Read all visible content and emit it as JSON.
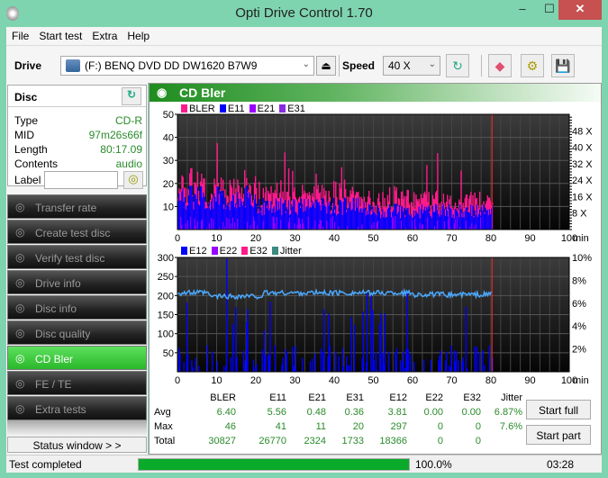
{
  "window": {
    "title": "Opti Drive Control 1.70",
    "minimize": "‒",
    "maximize": "☐",
    "close": "✕"
  },
  "menu": [
    "File",
    "Start test",
    "Extra",
    "Help"
  ],
  "toolbar": {
    "drive_label": "Drive",
    "drive_value": "(F:)   BENQ DVD DD DW1620 B7W9",
    "speed_label": "Speed",
    "speed_value": "40 X",
    "eject": "⏏",
    "refresh": "↻",
    "erase": "◆",
    "settings": "⚙",
    "save": "💾"
  },
  "disc": {
    "header": "Disc",
    "rows": [
      {
        "key": "Type",
        "value": "CD-R"
      },
      {
        "key": "MID",
        "value": "97m26s66f"
      },
      {
        "key": "Length",
        "value": "80:17.09"
      },
      {
        "key": "Contents",
        "value": "audio"
      }
    ],
    "label_key": "Label",
    "label_value": ""
  },
  "nav": [
    {
      "label": "Transfer rate",
      "active": false
    },
    {
      "label": "Create test disc",
      "active": false
    },
    {
      "label": "Verify test disc",
      "active": false
    },
    {
      "label": "Drive info",
      "active": false
    },
    {
      "label": "Disc info",
      "active": false
    },
    {
      "label": "Disc quality",
      "active": false
    },
    {
      "label": "CD Bler",
      "active": true
    },
    {
      "label": "FE / TE",
      "active": false
    },
    {
      "label": "Extra tests",
      "active": false
    }
  ],
  "status_window": "Status window > >",
  "panel_title": "CD Bler",
  "chart_data": [
    {
      "type": "bar",
      "title": "CD Bler upper",
      "legend": [
        {
          "name": "BLER",
          "color": "#ff1a8c"
        },
        {
          "name": "E11",
          "color": "#0000ff"
        },
        {
          "name": "E21",
          "color": "#9900ff"
        },
        {
          "name": "E31",
          "color": "#8a2be2"
        }
      ],
      "xlabel": "min",
      "x_ticks": [
        "0",
        "10",
        "20",
        "30",
        "40",
        "50",
        "60",
        "70",
        "80",
        "90",
        "100"
      ],
      "y_ticks": [
        "10",
        "20",
        "30",
        "40",
        "50"
      ],
      "y2_ticks": [
        "8 X",
        "16 X",
        "24 X",
        "32 X",
        "40 X",
        "48 X"
      ],
      "ylim": [
        0,
        50
      ],
      "xlim": [
        0,
        100
      ],
      "end_marker_min": 80.3,
      "bler_max": 46,
      "bler_avg": 6.4
    },
    {
      "type": "bar",
      "title": "CD Bler lower",
      "legend": [
        {
          "name": "E12",
          "color": "#0000ff"
        },
        {
          "name": "E22",
          "color": "#9900ff"
        },
        {
          "name": "E32",
          "color": "#ff1a8c"
        },
        {
          "name": "Jitter",
          "color": "#3a8a80"
        }
      ],
      "xlabel": "min",
      "x_ticks": [
        "0",
        "10",
        "20",
        "30",
        "40",
        "50",
        "60",
        "70",
        "80",
        "90",
        "100"
      ],
      "y_ticks": [
        "50",
        "100",
        "150",
        "200",
        "250",
        "300"
      ],
      "y2_ticks": [
        "2%",
        "4%",
        "6%",
        "8%",
        "10%"
      ],
      "ylim": [
        0,
        300
      ],
      "y2lim": [
        0,
        10
      ],
      "xlim": [
        0,
        100
      ],
      "end_marker_min": 80.3,
      "jitter_avg_pct": 6.87,
      "e12_max": 297
    }
  ],
  "stats": {
    "columns": [
      "BLER",
      "E11",
      "E21",
      "E31",
      "E12",
      "E22",
      "E32",
      "Jitter"
    ],
    "rows": [
      {
        "label": "Avg",
        "values": [
          "6.40",
          "5.56",
          "0.48",
          "0.36",
          "3.81",
          "0.00",
          "0.00",
          "6.87%"
        ]
      },
      {
        "label": "Max",
        "values": [
          "46",
          "41",
          "11",
          "20",
          "297",
          "0",
          "0",
          "7.6%"
        ]
      },
      {
        "label": "Total",
        "values": [
          "30827",
          "26770",
          "2324",
          "1733",
          "18366",
          "0",
          "0",
          ""
        ]
      }
    ]
  },
  "buttons": {
    "start_full": "Start full",
    "start_part": "Start part"
  },
  "statusbar": {
    "text": "Test completed",
    "progress": 100.0,
    "progress_text": "100.0%",
    "time": "03:28"
  }
}
